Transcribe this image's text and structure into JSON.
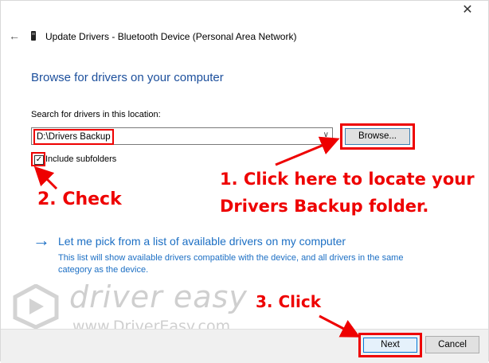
{
  "window": {
    "close_glyph": "✕",
    "title": "Update Drivers - Bluetooth Device (Personal Area Network)"
  },
  "page": {
    "heading": "Browse for drivers on your computer",
    "search_label": "Search for drivers in this location:",
    "path_value": "D:\\Drivers Backup",
    "browse_label": "Browse...",
    "include_subfolders_label": "Include subfolders",
    "include_subfolders_checked": true,
    "pick_link": "Let me pick from a list of available drivers on my computer",
    "pick_desc": "This list will show available drivers compatible with the device, and all drivers in the same category as the device."
  },
  "footer": {
    "next_label": "Next",
    "cancel_label": "Cancel"
  },
  "annotations": {
    "step1_line1": "1. Click here to locate your",
    "step1_line2": "Drivers Backup folder.",
    "step2": "2. Check",
    "step3": "3. Click"
  },
  "watermark": {
    "brand": "driver easy",
    "url": "www.DriverEasy.com"
  },
  "colors": {
    "accent_blue": "#1c6fc4",
    "annotation_red": "#ee0000",
    "footer_bg": "#f0f0f0"
  },
  "icons": {
    "back": "back-arrow-icon",
    "device": "bluetooth-device-icon",
    "close": "close-icon",
    "link_arrow": "right-arrow-icon"
  }
}
